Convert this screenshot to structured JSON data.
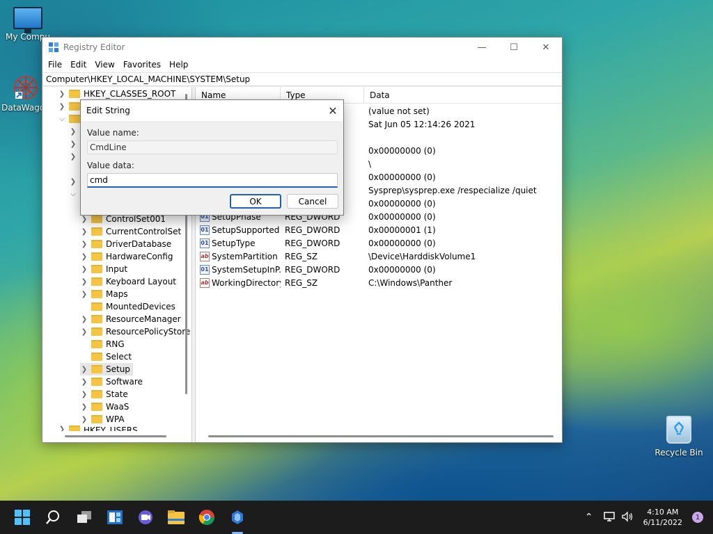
{
  "desktop": {
    "icons": [
      {
        "label": "My Compu"
      },
      {
        "label": "DataWagon"
      },
      {
        "label": "Recycle Bin"
      }
    ]
  },
  "window": {
    "title": "Registry Editor",
    "menu": [
      "File",
      "Edit",
      "View",
      "Favorites",
      "Help"
    ],
    "address": "Computer\\HKEY_LOCAL_MACHINE\\SYSTEM\\Setup",
    "controls": {
      "minimize": "—",
      "maximize": "☐",
      "close": "✕"
    }
  },
  "tree": {
    "top_item": "HKEY_CLASSES_ROOT",
    "items": [
      "ControlSet001",
      "CurrentControlSet",
      "DriverDatabase",
      "HardwareConfig",
      "Input",
      "Keyboard Layout",
      "Maps",
      "MountedDevices",
      "ResourceManager",
      "ResourcePolicyStore",
      "RNG",
      "Select",
      "Setup",
      "Software",
      "State",
      "WaaS",
      "WPA"
    ],
    "bottom_item": "HKEY_USERS",
    "selected": "Setup"
  },
  "list": {
    "columns": [
      "Name",
      "Type",
      "Data"
    ],
    "hidden_data": [
      "(value not set)",
      "Sat Jun 05 12:14:26 2021",
      "",
      "0x00000000 (0)",
      "\\",
      "0x00000000 (0)",
      "Sysprep\\sysprep.exe /respecialize /quiet",
      "0x00000000 (0)"
    ],
    "rows": [
      {
        "name": "SetupPhase",
        "type": "REG_DWORD",
        "data": "0x00000000 (0)",
        "kind": "dword"
      },
      {
        "name": "SetupSupported",
        "type": "REG_DWORD",
        "data": "0x00000001 (1)",
        "kind": "dword"
      },
      {
        "name": "SetupType",
        "type": "REG_DWORD",
        "data": "0x00000000 (0)",
        "kind": "dword"
      },
      {
        "name": "SystemPartition",
        "type": "REG_SZ",
        "data": "\\Device\\HarddiskVolume1",
        "kind": "sz"
      },
      {
        "name": "SystemSetupInP...",
        "type": "REG_DWORD",
        "data": "0x00000000 (0)",
        "kind": "dword"
      },
      {
        "name": "WorkingDirectory",
        "type": "REG_SZ",
        "data": "C:\\Windows\\Panther",
        "kind": "sz"
      }
    ]
  },
  "dialog": {
    "title": "Edit String",
    "value_name_label": "Value name:",
    "value_name": "CmdLine",
    "value_data_label": "Value data:",
    "value_data": "cmd",
    "ok": "OK",
    "cancel": "Cancel",
    "close": "✕"
  },
  "taskbar": {
    "time": "4:10 AM",
    "date": "6/11/2022",
    "notifications": "1",
    "apps": [
      "start-icon",
      "search-icon",
      "task-view-icon",
      "widgets-icon",
      "chat-icon",
      "file-explorer-icon",
      "chrome-icon",
      "datawagon-icon"
    ]
  }
}
